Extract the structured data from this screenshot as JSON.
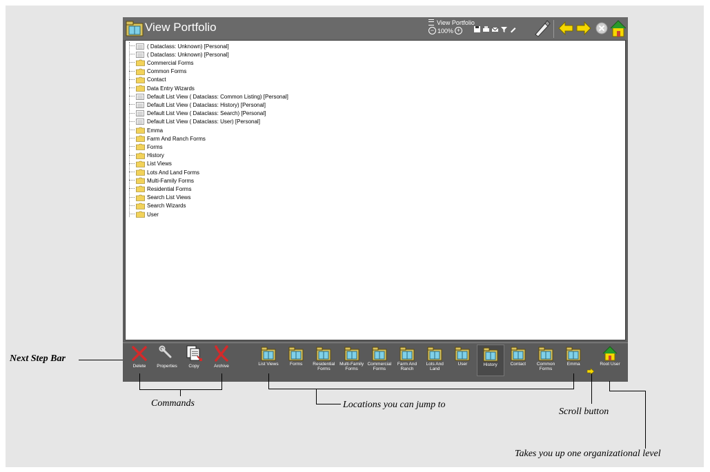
{
  "window": {
    "title": "View Portfolio",
    "top_label": "View Portfolio",
    "zoom_level": "100%"
  },
  "tree": {
    "items": [
      {
        "label": "( Dataclass: Unknown) [Personal]",
        "kind": "list"
      },
      {
        "label": "( Dataclass: Unknown) [Personal]",
        "kind": "list"
      },
      {
        "label": "Commercial Forms",
        "kind": "folder"
      },
      {
        "label": "Common Forms",
        "kind": "folder"
      },
      {
        "label": "Contact",
        "kind": "folder"
      },
      {
        "label": "Data Entry Wizards",
        "kind": "folder"
      },
      {
        "label": "Default List View ( Dataclass: Common Listing) [Personal]",
        "kind": "list"
      },
      {
        "label": "Default List View ( Dataclass: History) [Personal]",
        "kind": "list"
      },
      {
        "label": "Default List View ( Dataclass: Search) [Personal]",
        "kind": "list"
      },
      {
        "label": "Default List View ( Dataclass: User) [Personal]",
        "kind": "list"
      },
      {
        "label": "Emma",
        "kind": "folder"
      },
      {
        "label": "Farm And Ranch Forms",
        "kind": "folder"
      },
      {
        "label": "Forms",
        "kind": "folder"
      },
      {
        "label": "History",
        "kind": "folder"
      },
      {
        "label": "List Views",
        "kind": "folder"
      },
      {
        "label": "Lots And Land Forms",
        "kind": "folder"
      },
      {
        "label": "Multi-Family Forms",
        "kind": "folder"
      },
      {
        "label": "Residential Forms",
        "kind": "folder"
      },
      {
        "label": "Search List Views",
        "kind": "folder"
      },
      {
        "label": "Search Wizards",
        "kind": "folder"
      },
      {
        "label": "User",
        "kind": "folder"
      }
    ]
  },
  "next_step_bar": {
    "commands": [
      {
        "label": "Delete",
        "icon": "delete-x-icon"
      },
      {
        "label": "Properties",
        "icon": "wrench-icon"
      },
      {
        "label": "Copy",
        "icon": "copy-icon"
      },
      {
        "label": "Archive",
        "icon": "archive-x-icon"
      }
    ],
    "locations": [
      {
        "label": "List Views",
        "active": false
      },
      {
        "label": "Forms",
        "active": false
      },
      {
        "label": "Residential Forms",
        "active": false
      },
      {
        "label": "Multi-Family Forms",
        "active": false
      },
      {
        "label": "Commercial Forms",
        "active": false
      },
      {
        "label": "Farm And Ranch",
        "active": false
      },
      {
        "label": "Lots And Land",
        "active": false
      },
      {
        "label": "User",
        "active": false
      },
      {
        "label": "History",
        "active": true
      },
      {
        "label": "Contact",
        "active": false
      },
      {
        "label": "Common Forms",
        "active": false
      },
      {
        "label": "Emma",
        "active": false
      }
    ],
    "root": {
      "label": "Root User",
      "icon": "home-icon"
    }
  },
  "annotations": {
    "next_step_bar": "Next Step Bar",
    "commands": "Commands",
    "locations": "Locations you can jump to",
    "scroll": "Scroll button",
    "up_level": "Takes you up one organizational level"
  },
  "colors": {
    "window_bg": "#5e5e5e",
    "titlebar": "#6a6a6a",
    "folder": "#f2d25a",
    "arrow": "#f5d800",
    "delete": "#cc2222"
  }
}
